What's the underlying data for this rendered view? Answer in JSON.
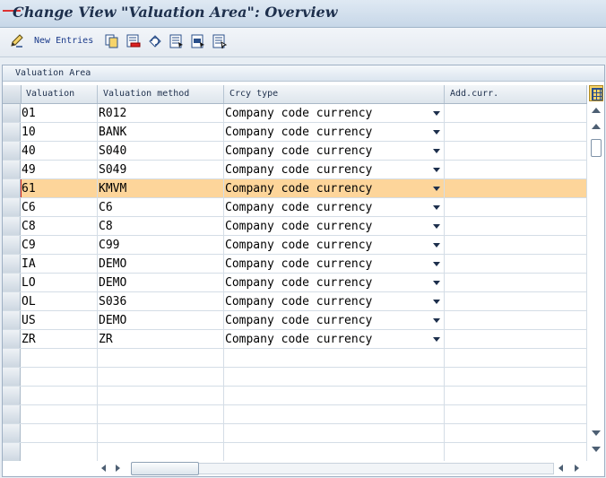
{
  "window": {
    "title": "Change View \"Valuation Area\": Overview"
  },
  "toolbar": {
    "new_entries_label": "New Entries",
    "icons": [
      "display-change-icon",
      "copy-icon",
      "delete-icon",
      "undo-change-icon",
      "select-all-icon",
      "select-block-icon",
      "deselect-all-icon"
    ]
  },
  "panel": {
    "title": "Valuation Area"
  },
  "table": {
    "columns": [
      "Valuation",
      "Valuation method",
      "Crcy type",
      "Add.curr."
    ],
    "rows": [
      {
        "valuation": "01",
        "method": "R012",
        "crcy_type": "Company code currency",
        "add_curr": ""
      },
      {
        "valuation": "10",
        "method": "BANK",
        "crcy_type": "Company code currency",
        "add_curr": ""
      },
      {
        "valuation": "40",
        "method": "S040",
        "crcy_type": "Company code currency",
        "add_curr": ""
      },
      {
        "valuation": "49",
        "method": "S049",
        "crcy_type": "Company code currency",
        "add_curr": ""
      },
      {
        "valuation": "61",
        "method": "KMVM",
        "crcy_type": "Company code currency",
        "add_curr": ""
      },
      {
        "valuation": "C6",
        "method": "C6",
        "crcy_type": "Company code currency",
        "add_curr": ""
      },
      {
        "valuation": "C8",
        "method": "C8",
        "crcy_type": "Company code currency",
        "add_curr": ""
      },
      {
        "valuation": "C9",
        "method": "C99",
        "crcy_type": "Company code currency",
        "add_curr": ""
      },
      {
        "valuation": "IA",
        "method": "DEMO",
        "crcy_type": "Company code currency",
        "add_curr": ""
      },
      {
        "valuation": "LO",
        "method": "DEMO",
        "crcy_type": "Company code currency",
        "add_curr": ""
      },
      {
        "valuation": "OL",
        "method": "S036",
        "crcy_type": "Company code currency",
        "add_curr": ""
      },
      {
        "valuation": "US",
        "method": "DEMO",
        "crcy_type": "Company code currency",
        "add_curr": ""
      },
      {
        "valuation": "ZR",
        "method": "ZR",
        "crcy_type": "Company code currency",
        "add_curr": ""
      }
    ],
    "selected_row_index": 4,
    "empty_rows": 6
  },
  "colors": {
    "selected_row": "#fdd59a",
    "title_text": "#1d2f4c",
    "link_blue": "#1a3a8a"
  }
}
